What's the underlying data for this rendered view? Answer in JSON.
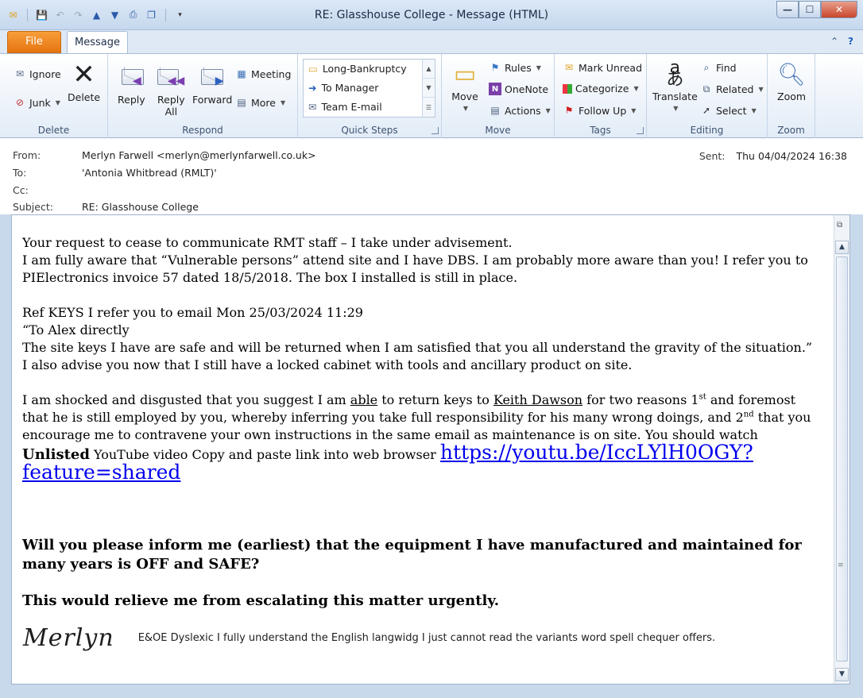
{
  "window": {
    "title": "RE: Glasshouse College  -  Message (HTML)",
    "min_glyph": "—",
    "max_glyph": "☐",
    "close_glyph": "✕"
  },
  "tabs": {
    "file": "File",
    "message": "Message"
  },
  "ribbon": {
    "delete": {
      "label": "Delete",
      "ignore": "Ignore",
      "junk": "Junk",
      "delete": "Delete"
    },
    "respond": {
      "label": "Respond",
      "reply": "Reply",
      "reply_all_1": "Reply",
      "reply_all_2": "All",
      "forward": "Forward",
      "meeting": "Meeting",
      "more": "More"
    },
    "quick_steps": {
      "label": "Quick Steps",
      "items": [
        "Long-Bankruptcy",
        "To Manager",
        "Team E-mail"
      ]
    },
    "move": {
      "label": "Move",
      "move": "Move",
      "rules": "Rules",
      "onenote": "OneNote",
      "actions": "Actions"
    },
    "tags": {
      "label": "Tags",
      "mark_unread": "Mark Unread",
      "categorize": "Categorize",
      "follow_up": "Follow Up"
    },
    "editing": {
      "label": "Editing",
      "translate": "Translate",
      "find": "Find",
      "related": "Related",
      "select": "Select"
    },
    "zoom": {
      "label": "Zoom",
      "zoom": "Zoom"
    }
  },
  "header": {
    "from_label": "From:",
    "from_value": "Merlyn Farwell <merlyn@merlynfarwell.co.uk>",
    "to_label": "To:",
    "to_value": "'Antonia Whitbread (RMLT)'",
    "cc_label": "Cc:",
    "subject_label": "Subject:",
    "subject_value": "RE: Glasshouse College",
    "sent_label": "Sent:",
    "sent_value": "Thu 04/04/2024 16:38"
  },
  "body": {
    "p1a": "Your request to cease to communicate RMT staff – I take under advisement.",
    "p1b": "I am fully aware that “Vulnerable persons” attend site and I have DBS. I am probably more aware than you! I refer you to PIElectronics invoice 57 dated 18/5/2018. The box I installed is still in place.",
    "p2a": "Ref KEYS I refer you to email Mon 25/03/2024 11:29",
    "p2b": "“To Alex directly",
    "p2c": "The site keys I have are safe and will be returned when I am satisfied that you all understand the gravity of the situation.”",
    "p2d": "I also advise you now that I still have a locked cabinet with tools and ancillary product on site.",
    "p3_1": "I am shocked and disgusted that you suggest I am ",
    "p3_able": "able",
    "p3_2": " to return keys to ",
    "p3_keith": "Keith Dawson",
    "p3_3": " for two reasons 1",
    "p3_st": "st",
    "p3_4": " and foremost that he is still employed by you, whereby inferring you take full responsibility for his many wrong doings, and 2",
    "p3_nd": "nd",
    "p3_5": " that you encourage me to contravene your own instructions in the same email as maintenance is on site. You should watch ",
    "p3_unlisted": "Unlisted",
    "p3_6": " YouTube video Copy and paste link into web browser ",
    "p3_link": "https://youtu.be/IccLYlH0OGY?feature=shared",
    "p4": "Will you please inform me (earliest) that the equipment I have manufactured and maintained for many years is OFF and SAFE?",
    "p5": "This would relieve me from escalating this matter urgently.",
    "signature": "Merlyn",
    "eoe": "E&OE Dyslexic  I fully understand the English langwidg I just cannot read the variants word spell chequer offers."
  }
}
